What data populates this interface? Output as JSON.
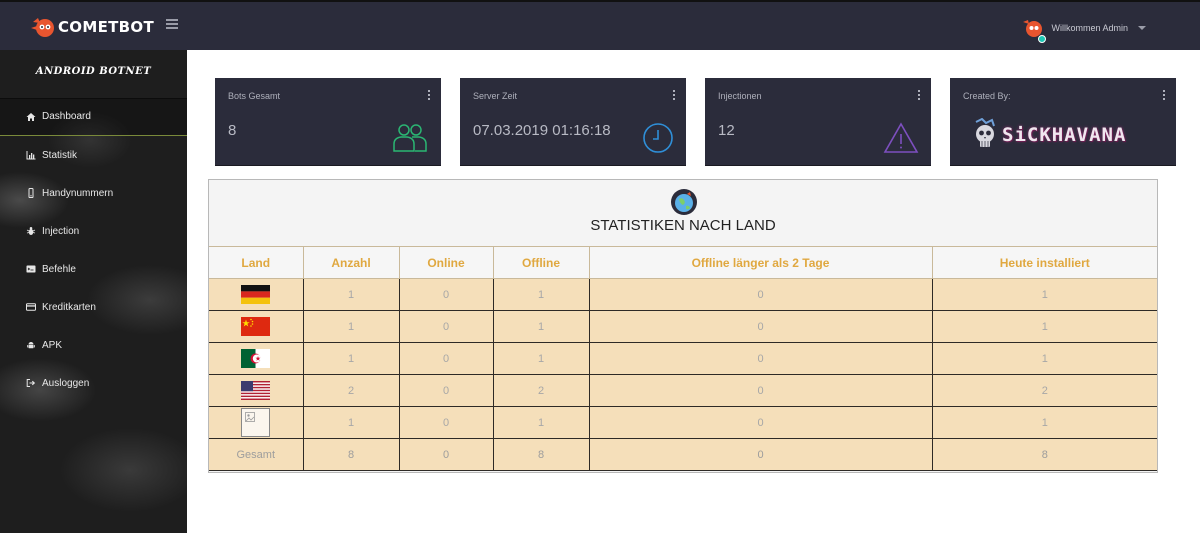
{
  "header": {
    "brand_name": "COMETBOT",
    "user_greeting": "Willkommen Admin"
  },
  "sidebar": {
    "title": "ANDROID BOTNET",
    "items": [
      {
        "label": "Dashboard",
        "icon": "home-icon",
        "active": true
      },
      {
        "label": "Statistik",
        "icon": "bar-chart-icon",
        "active": false
      },
      {
        "label": "Handynummern",
        "icon": "mobile-icon",
        "active": false
      },
      {
        "label": "Injection",
        "icon": "bug-icon",
        "active": false
      },
      {
        "label": "Befehle",
        "icon": "terminal-icon",
        "active": false
      },
      {
        "label": "Kreditkarten",
        "icon": "credit-card-icon",
        "active": false
      },
      {
        "label": "APK",
        "icon": "android-icon",
        "active": false
      },
      {
        "label": "Ausloggen",
        "icon": "sign-out-icon",
        "active": false
      }
    ]
  },
  "cards": [
    {
      "title": "Bots Gesamt",
      "value": "8",
      "icon": "users-icon",
      "accent": "#2bb673"
    },
    {
      "title": "Server Zeit",
      "value": "07.03.2019 01:16:18",
      "icon": "clock-icon",
      "accent": "#2f8fd8"
    },
    {
      "title": "Injectionen",
      "value": "12",
      "icon": "warning-icon",
      "accent": "#7d4fbf"
    },
    {
      "title": "Created By:",
      "value": "SiCKHAVANA",
      "icon": "skull-icon",
      "accent": "#8a2a6a"
    }
  ],
  "stats": {
    "title": "STATISTIKEN NACH LAND",
    "columns": [
      "Land",
      "Anzahl",
      "Online",
      "Offline",
      "Offline länger als 2 Tage",
      "Heute installiert"
    ],
    "rows": [
      {
        "country": "germany-flag",
        "anzahl": "1",
        "online": "0",
        "offline": "1",
        "offline_2": "0",
        "heute": "1"
      },
      {
        "country": "china-flag",
        "anzahl": "1",
        "online": "0",
        "offline": "1",
        "offline_2": "0",
        "heute": "1"
      },
      {
        "country": "algeria-flag",
        "anzahl": "1",
        "online": "0",
        "offline": "1",
        "offline_2": "0",
        "heute": "1"
      },
      {
        "country": "usa-flag",
        "anzahl": "2",
        "online": "0",
        "offline": "2",
        "offline_2": "0",
        "heute": "2"
      },
      {
        "country": "unknown-flag",
        "anzahl": "1",
        "online": "0",
        "offline": "1",
        "offline_2": "0",
        "heute": "1"
      }
    ],
    "total": {
      "label": "Gesamt",
      "anzahl": "8",
      "online": "0",
      "offline": "8",
      "offline_2": "0",
      "heute": "8"
    }
  },
  "colors": {
    "topbar": "#2b2c3b",
    "table_header_text": "#e0a840",
    "table_row_bg": "#f5dfba"
  }
}
